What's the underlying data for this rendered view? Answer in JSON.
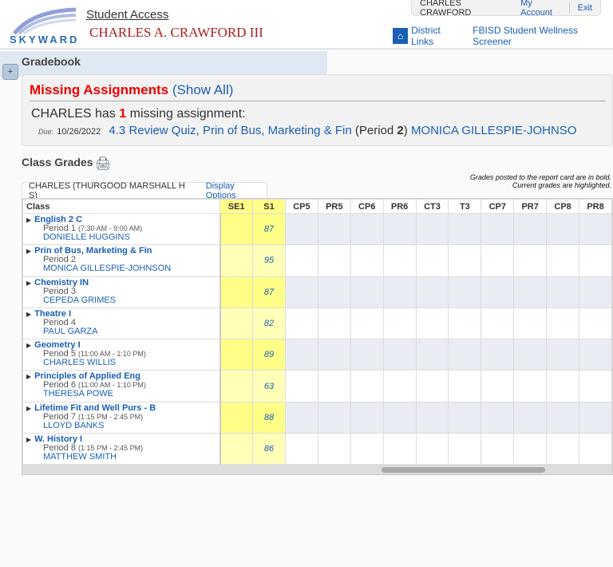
{
  "header": {
    "logo_text": "SKYWARD",
    "app_title": "Student Access",
    "student_name": "CHARLES A. CRAWFORD III",
    "user": "CHARLES CRAWFORD",
    "my_account": "My Account",
    "exit": "Exit",
    "district_links": "District Links",
    "wellness": "FBISD Student Wellness Screener"
  },
  "gradebook": {
    "title": "Gradebook",
    "expand": "+"
  },
  "missing": {
    "title": "Missing Assignments",
    "show_all": "(Show All)",
    "count_prefix": "CHARLES has",
    "count": "1",
    "count_suffix": "missing assignment:",
    "due_label": "Due:",
    "due_date": "10/26/2022",
    "assignment": "4.3 Review Quiz, Prin of Bus, Marketing & Fin",
    "period_prefix": "(Period",
    "period": "2",
    "period_suffix": ")",
    "teacher": "MONICA GILLESPIE-JOHNSO"
  },
  "class_grades": {
    "title": "Class Grades",
    "legend_line1": "Grades posted to the report card are in bold.",
    "legend_line2": "Current grades are highlighted.",
    "tab_label": "CHARLES (THURGOOD MARSHALL H S)",
    "display_options": "Display Options"
  },
  "table": {
    "headers": [
      "Class",
      "SE1",
      "S1",
      "CP5",
      "PR5",
      "CP6",
      "PR6",
      "CT3",
      "T3",
      "CP7",
      "PR7",
      "CP8",
      "PR8"
    ],
    "rows": [
      {
        "name": "English 2 C",
        "period": "Period 1",
        "time": "(7:30 AM - 9:00 AM)",
        "teacher": "DONIELLE HUGGINS",
        "se1": "",
        "s1": "87"
      },
      {
        "name": "Prin of Bus, Marketing & Fin",
        "period": "Period 2",
        "time": "",
        "teacher": "MONICA GILLESPIE-JOHNSON",
        "se1": "",
        "s1": "95"
      },
      {
        "name": "Chemistry IN",
        "period": "Period 3",
        "time": "",
        "teacher": "CEPEDA GRIMES",
        "se1": "",
        "s1": "87"
      },
      {
        "name": "Theatre I",
        "period": "Period 4",
        "time": "",
        "teacher": "PAUL GARZA",
        "se1": "",
        "s1": "82"
      },
      {
        "name": "Geometry I",
        "period": "Period 5",
        "time": "(11:00 AM - 1:10 PM)",
        "teacher": "CHARLES WILLIS",
        "se1": "",
        "s1": "89"
      },
      {
        "name": "Principles of Applied Eng",
        "period": "Period 6",
        "time": "(11:00 AM - 1:10 PM)",
        "teacher": "THERESA POWE",
        "se1": "",
        "s1": "63"
      },
      {
        "name": "Lifetime Fit and Well Purs - B",
        "period": "Period 7",
        "time": "(1:15 PM - 2:45 PM)",
        "teacher": "LLOYD BANKS",
        "se1": "",
        "s1": "88"
      },
      {
        "name": "W. History I",
        "period": "Period 8",
        "time": "(1:15 PM - 2:45 PM)",
        "teacher": "MATTHEW SMITH",
        "se1": "",
        "s1": "86"
      }
    ]
  }
}
